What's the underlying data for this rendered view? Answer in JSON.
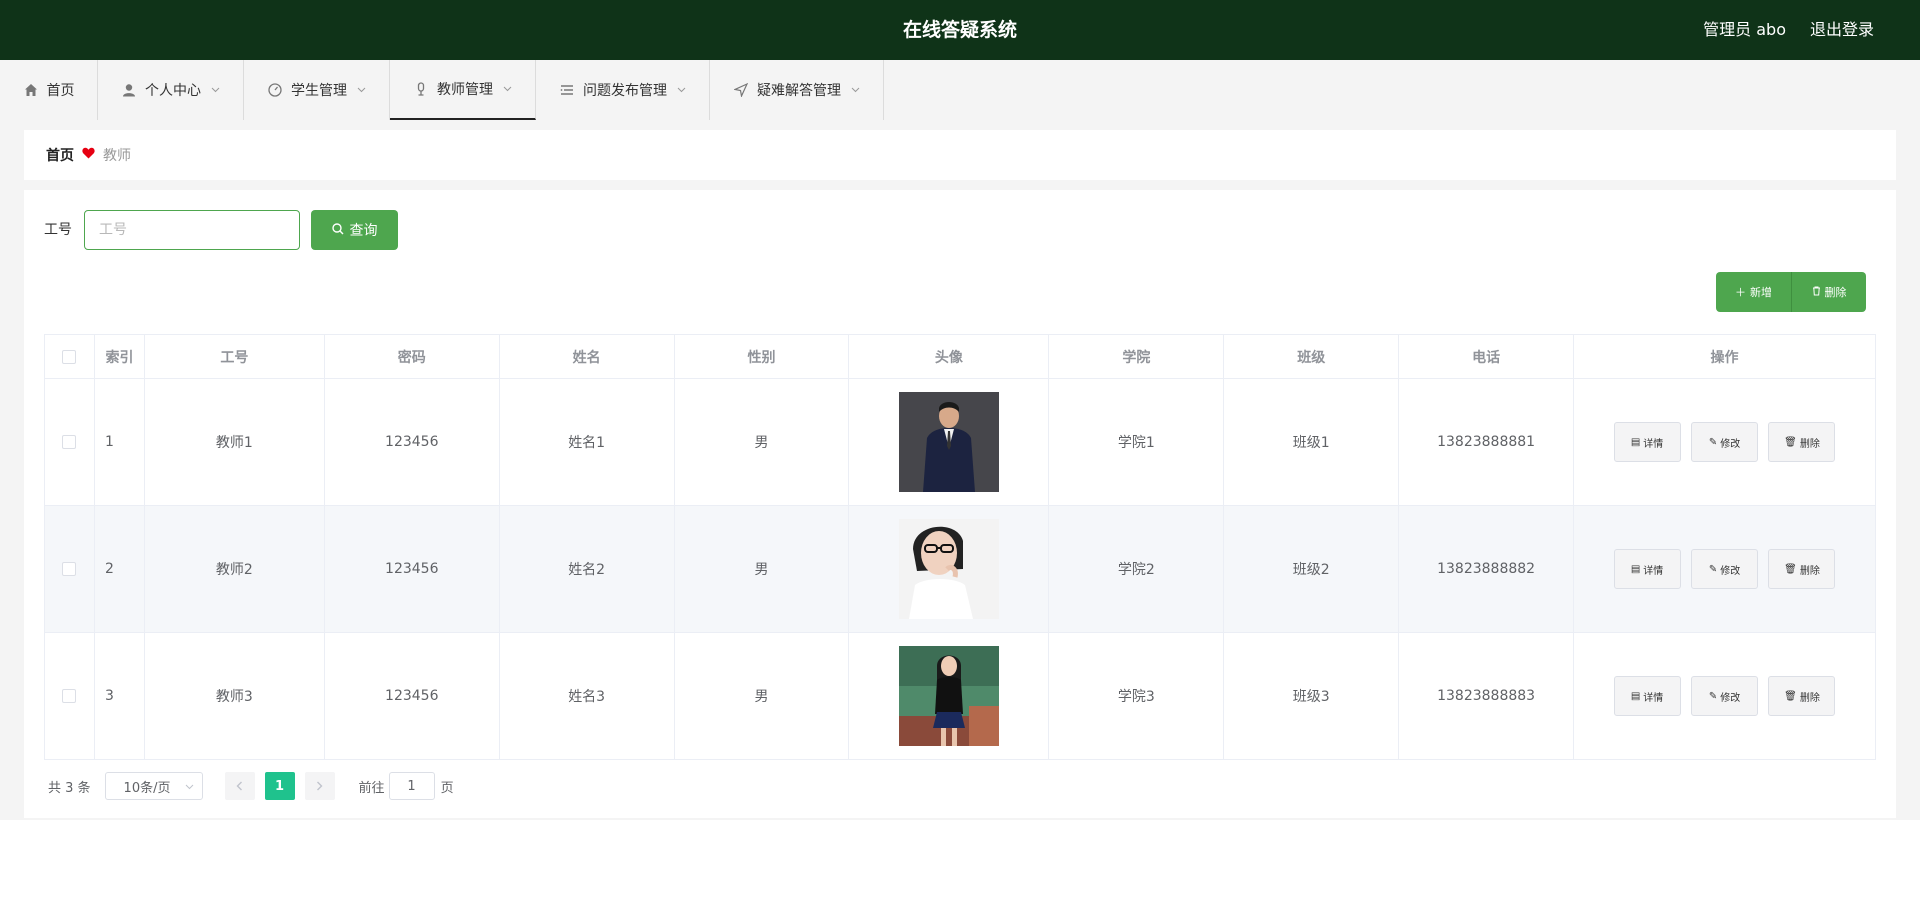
{
  "header": {
    "title": "在线答疑系统",
    "user": "管理员 abo",
    "logout": "退出登录"
  },
  "nav": [
    {
      "label": "首页",
      "icon": "home-icon"
    },
    {
      "label": "个人中心",
      "icon": "user-icon"
    },
    {
      "label": "学生管理",
      "icon": "gauge-icon"
    },
    {
      "label": "教师管理",
      "icon": "microphone-icon"
    },
    {
      "label": "问题发布管理",
      "icon": "list-icon"
    },
    {
      "label": "疑难解答管理",
      "icon": "navigation-icon"
    }
  ],
  "breadcrumb": {
    "home": "首页",
    "current": "教师"
  },
  "search": {
    "label": "工号",
    "placeholder": "工号",
    "value": "",
    "button": "查询"
  },
  "actions": {
    "add": "新增",
    "delete": "删除"
  },
  "table": {
    "headers": [
      "索引",
      "工号",
      "密码",
      "姓名",
      "性别",
      "头像",
      "学院",
      "班级",
      "电话",
      "操作"
    ],
    "rows": [
      {
        "index": "1",
        "id": "教师1",
        "password": "123456",
        "name": "姓名1",
        "gender": "男",
        "college": "学院1",
        "class": "班级1",
        "phone": "13823888881"
      },
      {
        "index": "2",
        "id": "教师2",
        "password": "123456",
        "name": "姓名2",
        "gender": "男",
        "college": "学院2",
        "class": "班级2",
        "phone": "13823888882"
      },
      {
        "index": "3",
        "id": "教师3",
        "password": "123456",
        "name": "姓名3",
        "gender": "男",
        "college": "学院3",
        "class": "班级3",
        "phone": "13823888883"
      }
    ],
    "ops": {
      "detail": "详情",
      "edit": "修改",
      "delete": "删除"
    }
  },
  "pagination": {
    "total": "共 3 条",
    "size": "10条/页",
    "current": "1",
    "goto_prefix": "前往",
    "goto_value": "1",
    "goto_suffix": "页"
  },
  "colors": {
    "header_bg": "#0f3318",
    "primary": "#4ea64e",
    "page_active": "#1fc28d",
    "heart": "#e60012"
  }
}
